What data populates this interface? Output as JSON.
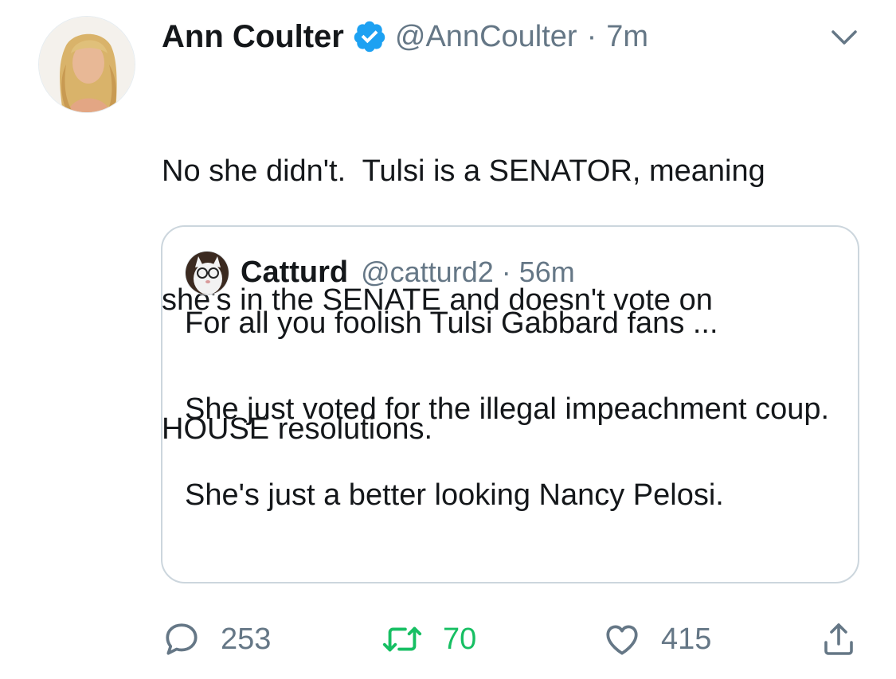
{
  "tweet": {
    "author": {
      "name": "Ann Coulter",
      "handle": "@AnnCoulter",
      "verified": true,
      "avatar_icon": "profile-photo-blonde-woman"
    },
    "separator": "·",
    "time": "7m",
    "text_lines": [
      "No she didn't.  Tulsi is a SENATOR, meaning",
      "she's in the SENATE and doesn't vote on",
      "HOUSE resolutions."
    ],
    "quoted": {
      "author": {
        "name": "Catturd",
        "handle": "@catturd2",
        "avatar_icon": "cat-with-glasses-avatar"
      },
      "separator": "·",
      "time": "56m",
      "paragraphs": [
        "For all you foolish Tulsi Gabbard fans ...",
        "She just voted for the illegal impeachment coup.",
        "She's just a better looking Nancy Pelosi."
      ]
    },
    "actions": {
      "reply_count": "253",
      "retweet_count": "70",
      "like_count": "415"
    }
  },
  "colors": {
    "text_primary": "#14171a",
    "text_secondary": "#657786",
    "verified_blue": "#1da1f2",
    "retweet_green": "#17bf63",
    "quote_border": "#ccd6dd"
  }
}
